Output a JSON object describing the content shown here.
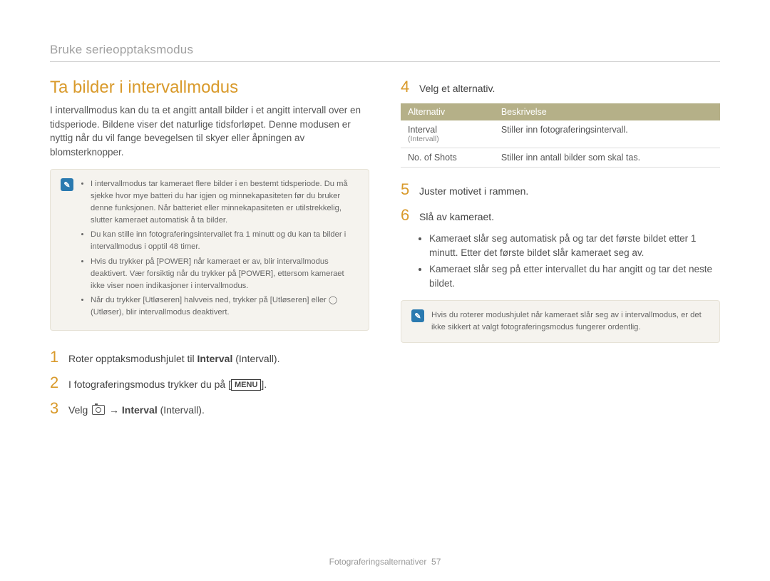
{
  "breadcrumb": "Bruke serieopptaksmodus",
  "heading": "Ta bilder i intervallmodus",
  "intro": "I intervallmodus kan du ta et angitt antall bilder i et angitt intervall over en tidsperiode. Bildene viser det naturlige tidsforløpet. Denne modusen er nyttig når du vil fange bevegelsen til skyer eller åpningen av blomsterknopper.",
  "note1": {
    "items": [
      "I intervallmodus tar kameraet flere bilder i en bestemt tidsperiode. Du må sjekke hvor mye batteri du har igjen og minnekapasiteten før du bruker denne funksjonen. Når batteriet eller minnekapasiteten er utilstrekkelig, slutter kameraet automatisk å ta bilder.",
      "Du kan stille inn fotograferingsintervallet fra 1 minutt og du kan ta bilder i intervallmodus i opptil 48 timer.",
      "Hvis du trykker på [POWER] når kameraet er av, blir intervallmodus deaktivert. Vær forsiktig når du trykker på [POWER], ettersom kameraet ikke viser noen indikasjoner i intervallmodus.",
      "Når du trykker [Utløseren] halvveis ned, trykker på [Utløseren] eller ◯ (Utløser), blir intervallmodus deaktivert."
    ]
  },
  "steps_left": {
    "1": {
      "pre": "Roter opptaksmodushjulet til ",
      "bold": "Interval",
      "post": " (Intervall)."
    },
    "2": {
      "pre": "I fotograferingsmodus trykker du på [",
      "menu": "MENU",
      "post": "]."
    },
    "3": {
      "pre": "Velg ",
      "arrow": "→",
      "bold": "Interval",
      "post": " (Intervall)."
    }
  },
  "steps_right": {
    "4": "Velg et alternativ.",
    "5": "Juster motivet i rammen.",
    "6": "Slå av kameraet."
  },
  "table": {
    "headers": {
      "opt": "Alternativ",
      "desc": "Beskrivelse"
    },
    "rows": [
      {
        "opt": "Interval",
        "opt_sub": "(Intervall)",
        "desc": "Stiller inn fotograferingsintervall."
      },
      {
        "opt": "No. of Shots",
        "desc": "Stiller inn antall bilder som skal tas."
      }
    ]
  },
  "sub_list": [
    "Kameraet slår seg automatisk på og tar det første bildet etter 1 minutt. Etter det første bildet slår kameraet seg av.",
    "Kameraet slår seg på etter intervallet du har angitt og tar det neste bildet."
  ],
  "note2": "Hvis du roterer modushjulet når kameraet slår seg av i intervallmodus, er det ikke sikkert at valgt fotograferingsmodus fungerer ordentlig.",
  "footer": {
    "section": "Fotograferingsalternativer",
    "page": "57"
  }
}
